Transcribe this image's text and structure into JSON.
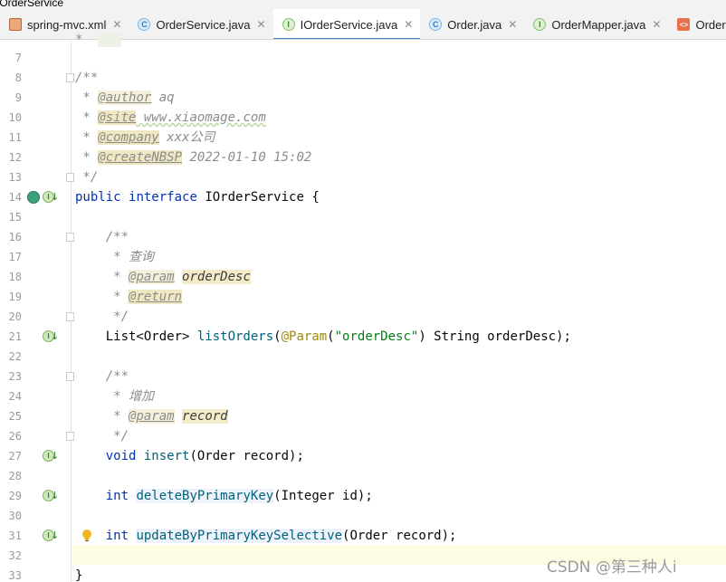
{
  "breadcrumb": "IOrderService",
  "tabs": [
    {
      "label": "spring-mvc.xml",
      "icon": "xml-file-icon",
      "active": false,
      "closable": true
    },
    {
      "label": "OrderService.java",
      "icon": "class-icon",
      "active": false,
      "closable": true
    },
    {
      "label": "IOrderService.java",
      "icon": "interface-icon",
      "active": true,
      "closable": false
    },
    {
      "label": "Order.java",
      "icon": "class-icon",
      "active": false,
      "closable": true
    },
    {
      "label": "OrderMapper.java",
      "icon": "interface-icon",
      "active": false,
      "closable": true
    },
    {
      "label": "OrderMa",
      "icon": "mapper-xml-icon",
      "active": false,
      "closable": false
    }
  ],
  "editor": {
    "current_line": 32,
    "lines": {
      "7": "",
      "8": "/**",
      "9": {
        "prefix": " * ",
        "tag": "@author",
        "rest": " aq"
      },
      "10": {
        "prefix": " * ",
        "tag": "@site",
        "rest": " www.xiaomage.com"
      },
      "11": {
        "prefix": " * ",
        "tag": "@company",
        "rest": " xxx公司"
      },
      "12": {
        "prefix": " * ",
        "tag": "@create",
        "tag2": "NBSP",
        "rest": " 2022-01-10 15:02"
      },
      "13": " */",
      "14": {
        "kw1": "public",
        "kw2": "interface",
        "name": "IOrderService",
        "rest": " {"
      },
      "15": "",
      "16": "    /**",
      "17": "     * 查询",
      "18": {
        "prefix": "     * ",
        "tag": "@param",
        "param": "orderDesc"
      },
      "19": {
        "prefix": "     * ",
        "tag": "@return"
      },
      "20": "     */",
      "21": {
        "type": "    List<Order> ",
        "fn": "listOrders",
        "open": "(",
        "ann": "@Param",
        "p1": "(",
        "str": "\"orderDesc\"",
        "rest": ") String orderDesc);"
      },
      "22": "",
      "23": "    /**",
      "24": "     * 增加",
      "25": {
        "prefix": "     * ",
        "tag": "@param",
        "param": "record"
      },
      "26": "     */",
      "27": {
        "kw": "void",
        "fn": "insert",
        "rest": "(Order record);"
      },
      "28": "",
      "29": {
        "kw": "int",
        "fn": "deleteByPrimaryKey",
        "rest": "(Integer id);"
      },
      "30": "",
      "31": {
        "kw": "int",
        "fn": "updateByPrimaryKeySelective",
        "rest": "(Order record);"
      },
      "32": "",
      "33": "}"
    }
  },
  "watermark": "CSDN @第三种人i",
  "colors": {
    "keyword": "#0033b3",
    "comment": "#8c8c8c",
    "method": "#00627a",
    "annotation": "#9e880d",
    "string": "#067d17",
    "current_line": "#fefbe3",
    "active_tab_underline": "#4083c9"
  }
}
